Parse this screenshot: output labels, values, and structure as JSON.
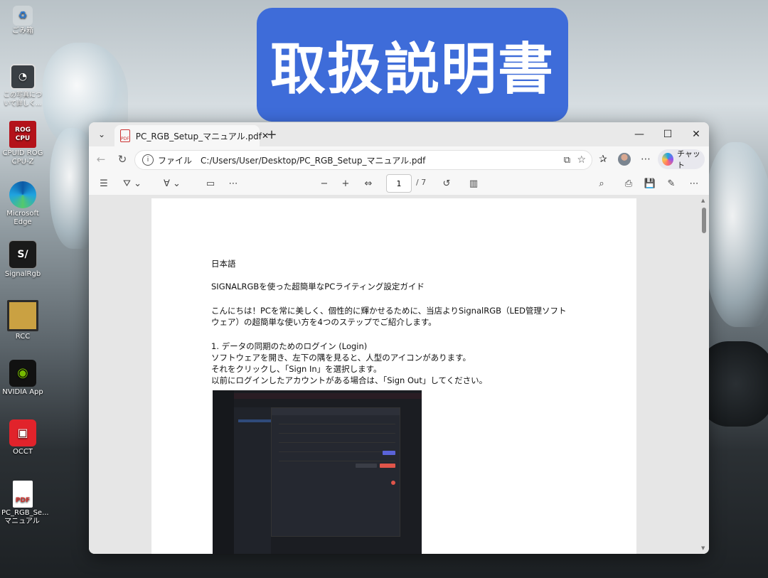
{
  "banner": {
    "title": "取扱説明書",
    "color": "#3e6cd9"
  },
  "desktop_icons": [
    {
      "label": "ごみ箱",
      "icon": "recycle-bin-icon"
    },
    {
      "label": "この写真について詳しく...",
      "icon": "camera-info-icon"
    },
    {
      "label": "CPUID ROG CPU-Z",
      "icon": "cpu-z-icon"
    },
    {
      "label": "Microsoft Edge",
      "icon": "edge-icon"
    },
    {
      "label": "SignalRgb",
      "icon": "signalrgb-icon"
    },
    {
      "label": "RCC",
      "icon": "rcc-icon"
    },
    {
      "label": "NVIDIA App",
      "icon": "nvidia-icon"
    },
    {
      "label": "OCCT",
      "icon": "occt-icon"
    },
    {
      "label": "PC_RGB_Se... マニュアル",
      "icon": "pdf-file-icon"
    }
  ],
  "browser": {
    "tab_title": "PC_RGB_Setup_マニュアル.pdf",
    "url_scheme": "ファイル",
    "url": "C:/Users/User/Desktop/PC_RGB_Setup_マニュアル.pdf",
    "chat_label": "チャット"
  },
  "pdf_toolbar": {
    "page_current": "1",
    "page_total": "/ 7"
  },
  "document": {
    "heading_lang": "日本語",
    "title": "SIGNALRGBを使った超簡単なPCライティング設定ガイド",
    "intro_line1": "こんにちは！PCを常に美しく、個性的に輝かせるために、当店よりSignalRGB（LED管理ソフト",
    "intro_line2": "ウェア）の超簡単な使い方を4つのステップでご紹介します。",
    "step1_title": "1. データの同期のためのログイン (Login)",
    "step1_line1": "ソフトウェアを開き、左下の隅を見ると、人型のアイコンがあります。",
    "step1_line2": "それをクリックし、「Sign In」を選択します。",
    "step1_line3": "以前にログインしたアカウントがある場合は、「Sign Out」してください。"
  }
}
